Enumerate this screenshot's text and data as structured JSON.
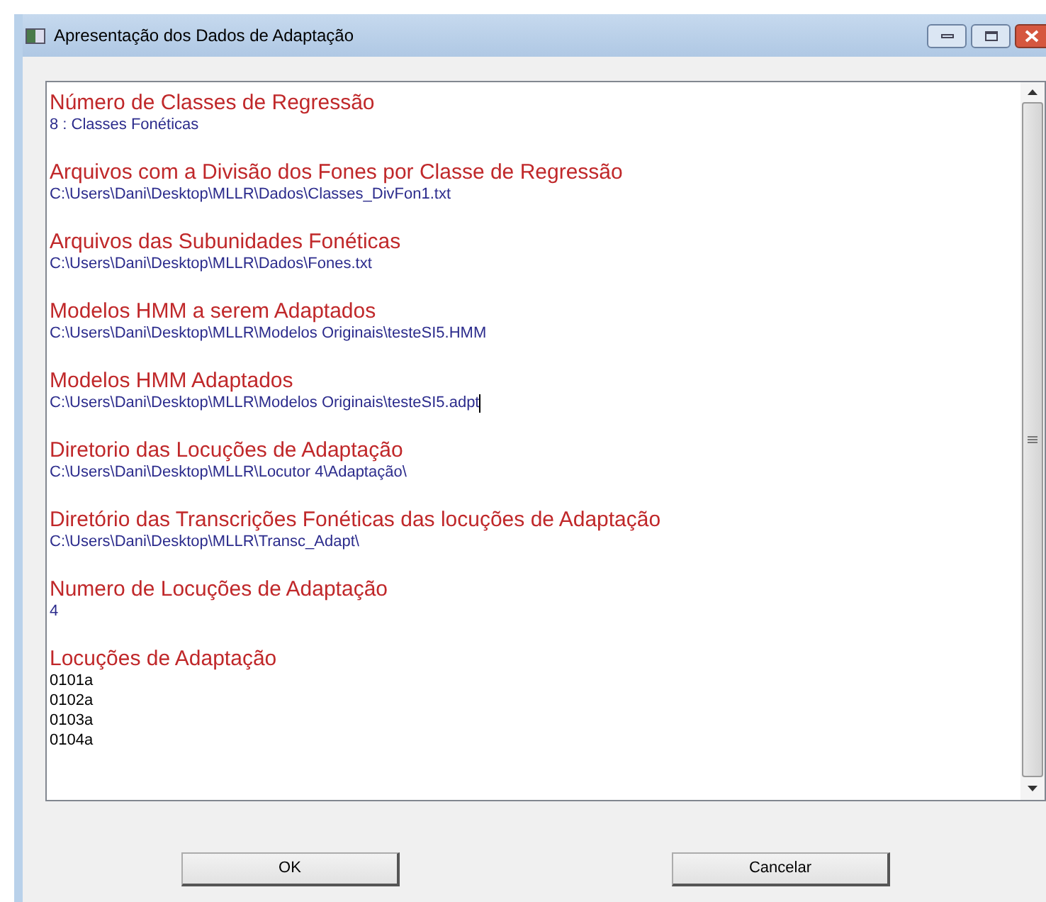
{
  "window": {
    "title": "Apresentação dos Dados de Adaptação"
  },
  "sections": [
    {
      "heading": "Número de Classes de Regressão",
      "kind": "value",
      "lines": [
        "8 : Classes Fonéticas"
      ],
      "caret": false
    },
    {
      "heading": "Arquivos com a Divisão dos Fones por Classe de Regressão",
      "kind": "value",
      "lines": [
        "C:\\Users\\Dani\\Desktop\\MLLR\\Dados\\Classes_DivFon1.txt"
      ],
      "caret": false
    },
    {
      "heading": "Arquivos das Subunidades Fonéticas",
      "kind": "value",
      "lines": [
        "C:\\Users\\Dani\\Desktop\\MLLR\\Dados\\Fones.txt"
      ],
      "caret": false
    },
    {
      "heading": "Modelos HMM a serem Adaptados",
      "kind": "value",
      "lines": [
        "C:\\Users\\Dani\\Desktop\\MLLR\\Modelos Originais\\testeSI5.HMM"
      ],
      "caret": false
    },
    {
      "heading": "Modelos HMM Adaptados",
      "kind": "value",
      "lines": [
        "C:\\Users\\Dani\\Desktop\\MLLR\\Modelos Originais\\testeSI5.adpt"
      ],
      "caret": true
    },
    {
      "heading": "Diretorio das Locuções de Adaptação",
      "kind": "value",
      "lines": [
        "C:\\Users\\Dani\\Desktop\\MLLR\\Locutor 4\\Adaptação\\"
      ],
      "caret": false
    },
    {
      "heading": "Diretório das Transcrições Fonéticas das locuções de Adaptação",
      "kind": "value",
      "lines": [
        "C:\\Users\\Dani\\Desktop\\MLLR\\Transc_Adapt\\"
      ],
      "caret": false
    },
    {
      "heading": "Numero de Locuções de Adaptação",
      "kind": "value",
      "lines": [
        "4"
      ],
      "caret": false
    },
    {
      "heading": "Locuções de Adaptação",
      "kind": "list",
      "lines": [
        "0101a",
        "0102a",
        "0103a",
        "0104a"
      ],
      "caret": false
    }
  ],
  "buttons": [
    "OK",
    "Cancelar"
  ]
}
